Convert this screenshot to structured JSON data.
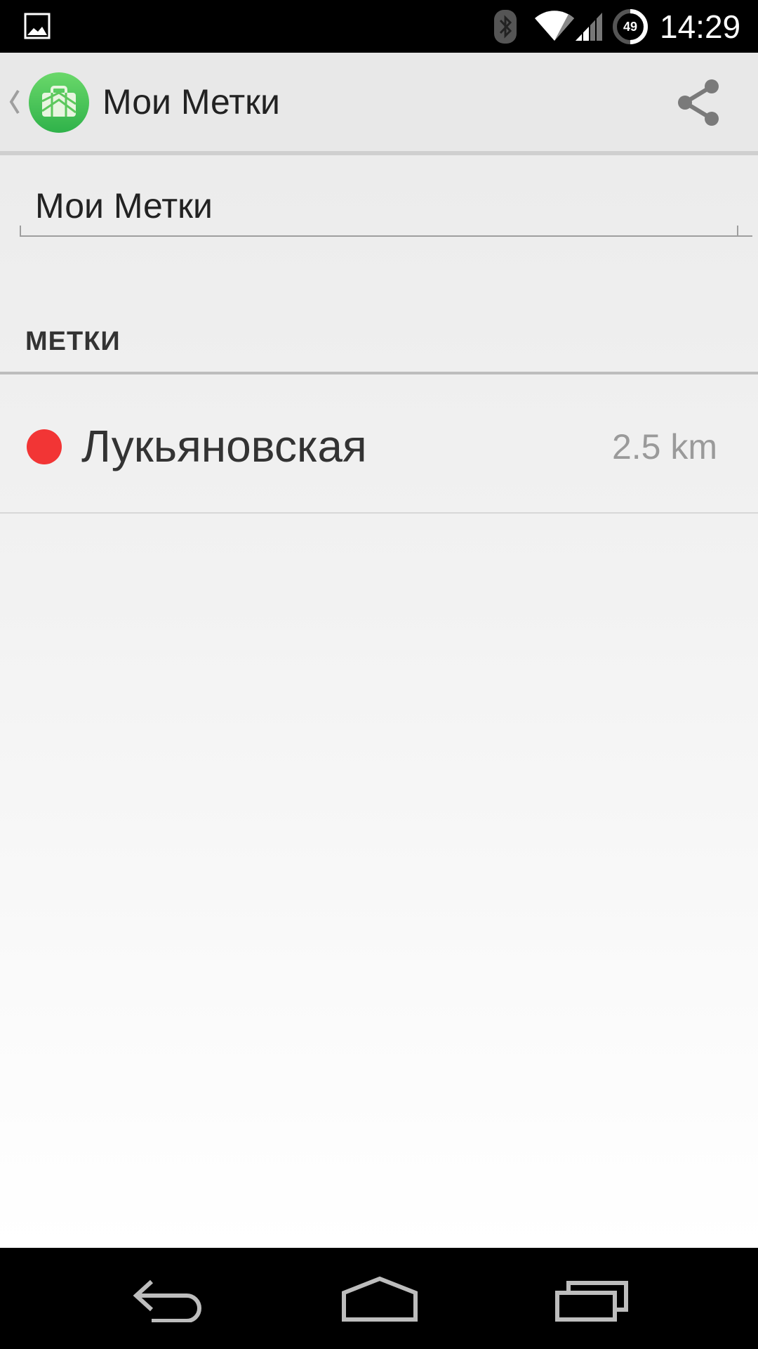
{
  "status_bar": {
    "time": "14:29",
    "battery_level": "49",
    "icons": [
      "gallery-notification-icon",
      "bluetooth-icon",
      "wifi-icon",
      "cell-signal-icon",
      "battery-icon"
    ]
  },
  "action_bar": {
    "title": "Мои Метки",
    "icons": [
      "back-chevron-icon",
      "app-logo-icon",
      "share-icon"
    ]
  },
  "form": {
    "list_name_value": "Мои Метки"
  },
  "section": {
    "header": "МЕТКИ"
  },
  "bookmarks": [
    {
      "name": "Лукьяновская",
      "distance": "2.5 km",
      "color": "#f23535"
    }
  ],
  "nav_bar": {
    "icons": [
      "nav-back-icon",
      "nav-home-icon",
      "nav-recents-icon"
    ]
  }
}
